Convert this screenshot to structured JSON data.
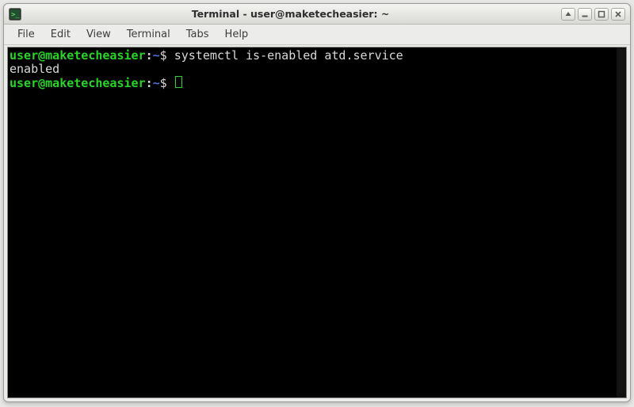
{
  "title": "Terminal - user@maketecheasier: ~",
  "menubar": {
    "file": "File",
    "edit": "Edit",
    "view": "View",
    "terminal": "Terminal",
    "tabs": "Tabs",
    "help": "Help"
  },
  "prompt": {
    "userhost": "user@maketecheasier",
    "sep": ":",
    "path": "~",
    "sigil": "$"
  },
  "lines": {
    "cmd1": "systemctl is-enabled atd.service",
    "out1": "enabled"
  },
  "icons": {
    "app": "terminal-icon",
    "scrollup": "arrow-up-icon",
    "minimize": "minimize-icon",
    "maximize": "maximize-icon",
    "close": "close-icon"
  }
}
